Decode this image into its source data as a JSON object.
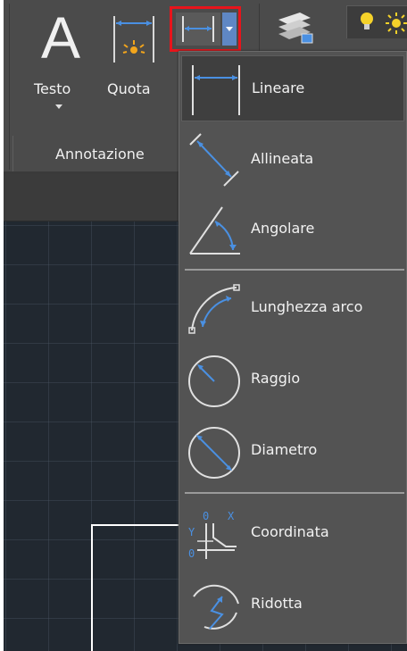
{
  "ribbon": {
    "testo_label": "Testo",
    "testo_glyph": "A",
    "quota_label": "Quota",
    "panel_title": "Annotazione",
    "dimension_split_button": {
      "icon": "linear-dimension-icon",
      "highlight_color": "#e8141b"
    }
  },
  "dropdown": {
    "items": [
      {
        "label": "Lineare",
        "icon": "linear-dimension-icon",
        "selected": true
      },
      {
        "label": "Allineata",
        "icon": "aligned-dimension-icon"
      },
      {
        "label": "Angolare",
        "icon": "angular-dimension-icon"
      },
      {
        "label": "Lunghezza arco",
        "icon": "arc-length-icon"
      },
      {
        "label": "Raggio",
        "icon": "radius-icon"
      },
      {
        "label": "Diametro",
        "icon": "diameter-icon"
      },
      {
        "label": "Coordinata",
        "icon": "ordinate-icon"
      },
      {
        "label": "Ridotta",
        "icon": "jogged-icon"
      }
    ]
  },
  "colors": {
    "accent_blue": "#4a90e2",
    "ribbon_bg": "#4b4b4b",
    "menu_bg": "#535353",
    "canvas_bg": "#212830"
  }
}
